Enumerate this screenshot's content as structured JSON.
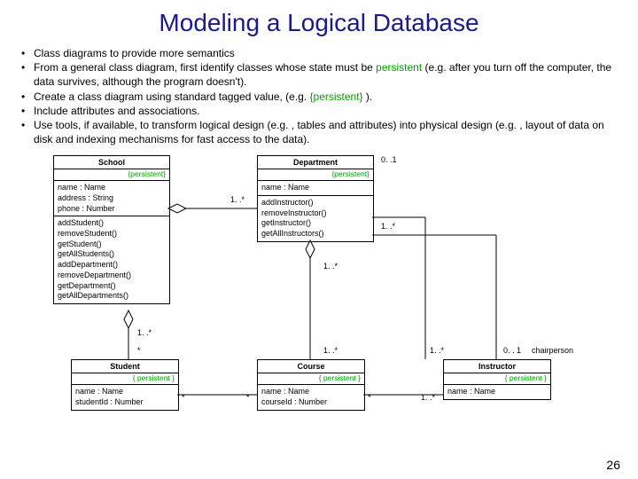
{
  "title": "Modeling a Logical Database",
  "bullets": {
    "b0": "Class diagrams to provide more semantics",
    "b1_a": "From a general class diagram, first identify classes whose state must be ",
    "b1_g": "persistent",
    "b1_b": " (e.g. after you turn off the computer, the data survives, although the program doesn't).",
    "b2_a": "Create a class diagram using standard tagged value, (e.g. ",
    "b2_g": "{persistent}",
    "b2_b": " ).",
    "b3": "Include attributes and associations.",
    "b4": "Use tools, if available, to transform logical design (e.g. , tables and attributes) into physical design (e.g. , layout of data on disk and indexing mechanisms for fast access to the data)."
  },
  "classes": {
    "school": {
      "name": "School",
      "tag": "{persistent}",
      "attrs": [
        "name : Name",
        "address : String",
        "phone : Number"
      ],
      "ops": [
        "addStudent()",
        "removeStudent()",
        "getStudent()",
        "getAllStudents()",
        "addDepartment()",
        "removeDepartment()",
        "getDepartment()",
        "getAllDepartments()"
      ]
    },
    "department": {
      "name": "Department",
      "tag": "{persistent}",
      "attrs": [
        "name : Name"
      ],
      "ops": [
        "addInstructor()",
        "removeInstructor()",
        "getInstructor()",
        "getAllInstructors()"
      ]
    },
    "student": {
      "name": "Student",
      "tag": "{ persistent }",
      "attrs": [
        "name : Name",
        "studentId : Number"
      ]
    },
    "course": {
      "name": "Course",
      "tag": "{ persistent }",
      "attrs": [
        "name : Name",
        "courseId : Number"
      ]
    },
    "instructor": {
      "name": "Instructor",
      "tag": "{ persistent }",
      "attrs": [
        "name : Name"
      ]
    }
  },
  "mult": {
    "m1s": "1. .*",
    "star": "*",
    "m01": "0. . 1",
    "m0_1": "0. .1"
  },
  "roles": {
    "chair": "chairperson"
  },
  "page": "26"
}
